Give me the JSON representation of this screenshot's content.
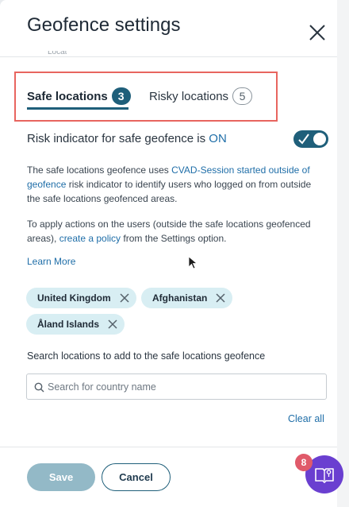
{
  "header": {
    "title": "Geofence settings",
    "close_icon": "close-icon",
    "cut_text": "Locat"
  },
  "tabs": [
    {
      "label": "Safe locations",
      "count": "3",
      "active": true
    },
    {
      "label": "Risky locations",
      "count": "5",
      "active": false
    }
  ],
  "risk_indicator": {
    "label": "Risk indicator for safe geofence is ",
    "state": "ON",
    "toggle_on": true
  },
  "description": {
    "p1_a": "The safe locations geofence uses ",
    "p1_link": "CVAD-Session started outside of geofence",
    "p1_b": " risk indicator to identify users who logged on from outside the safe locations geofenced areas.",
    "p2_a": "To apply actions on the users (outside the safe locations geofenced areas), ",
    "p2_link": "create a policy",
    "p2_b": " from the Settings option."
  },
  "learn_more": "Learn More",
  "chips": [
    "United Kingdom",
    "Afghanistan",
    "Åland Islands"
  ],
  "search": {
    "label": "Search locations to add to the safe locations geofence",
    "placeholder": "Search for country name",
    "value": ""
  },
  "clear_all": "Clear all",
  "footer": {
    "save": "Save",
    "cancel": "Cancel"
  },
  "help": {
    "count": "8",
    "icon": "help-book-icon"
  },
  "colors": {
    "accent": "#1f5f7a",
    "link": "#1f6ea8",
    "highlight_border": "#e8655f",
    "chip_bg": "#d8eef3",
    "save_disabled": "#93b9c7",
    "help_fab": "#6a3fd0",
    "help_badge": "#e05a6a"
  }
}
